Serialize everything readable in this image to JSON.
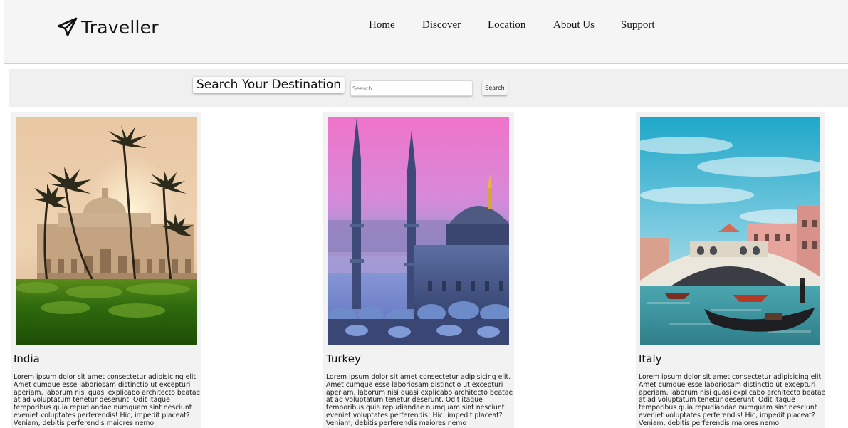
{
  "header": {
    "logo_text": "Traveller",
    "nav": [
      "Home",
      "Discover",
      "Location",
      "About Us",
      "Support"
    ]
  },
  "search": {
    "heading": "Search Your Destination",
    "placeholder": "Search",
    "button_label": "Search"
  },
  "destinations": [
    {
      "name": "India",
      "image": "Humayun's Tomb with palm trees at sunset",
      "description": "Lorem ipsum dolor sit amet consectetur adipisicing elit. Amet cumque esse laboriosam distinctio ut excepturi aperiam, laborum nisi quasi explicabo architecto beatae at ad voluptatum tenetur deserunt. Odit itaque temporibus quia repudiandae numquam sint nesciunt eveniet voluptates perferendis! Hic, impedit placeat? Veniam, debitis perferendis maiores nemo"
    },
    {
      "name": "Turkey",
      "image": "Blue Mosque at dusk with pink sky",
      "description": "Lorem ipsum dolor sit amet consectetur adipisicing elit. Amet cumque esse laboriosam distinctio ut excepturi aperiam, laborum nisi quasi explicabo architecto beatae at ad voluptatum tenetur deserunt. Odit itaque temporibus quia repudiandae numquam sint nesciunt eveniet voluptates perferendis! Hic, impedit placeat? Veniam, debitis perferendis maiores nemo"
    },
    {
      "name": "Italy",
      "image": "Rialto Bridge in Venice with gondola",
      "description": "Lorem ipsum dolor sit amet consectetur adipisicing elit. Amet cumque esse laboriosam distinctio ut excepturi aperiam, laborum nisi quasi explicabo architecto beatae at ad voluptatum tenetur deserunt. Odit itaque temporibus quia repudiandae numquam sint nesciunt eveniet voluptates perferendis! Hic, impedit placeat? Veniam, debitis perferendis maiores nemo"
    }
  ],
  "colors": {
    "header_bg": "#f5f5f5",
    "searchbar_bg": "#f0f0f0",
    "card_bg": "#f2f2f2",
    "text": "#111111"
  },
  "icons": {
    "logo": "paper-plane-icon"
  }
}
